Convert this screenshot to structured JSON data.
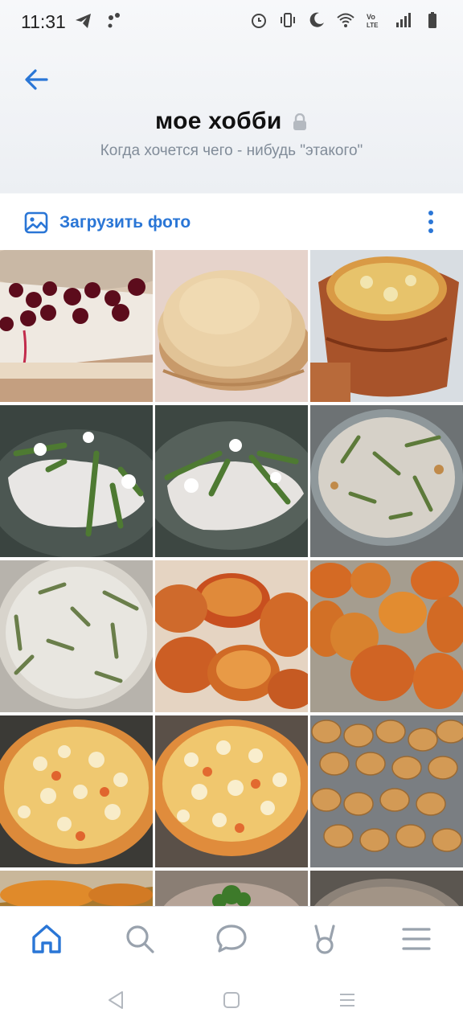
{
  "status_bar": {
    "time": "11:31"
  },
  "header": {
    "title": "мое хобби",
    "description": "Когда хочется чего - нибудь \"этакого\""
  },
  "actions": {
    "upload_label": "Загрузить фото"
  },
  "colors": {
    "accent": "#2a76d6",
    "secondary_text": "#818c99"
  },
  "photos": [
    {
      "subject": "cherry cake"
    },
    {
      "subject": "pancakes"
    },
    {
      "subject": "soup in clay pot"
    },
    {
      "subject": "fish with green beans"
    },
    {
      "subject": "fish with green beans"
    },
    {
      "subject": "green bean casserole"
    },
    {
      "subject": "green bean casserole"
    },
    {
      "subject": "baked pies"
    },
    {
      "subject": "baked pies"
    },
    {
      "subject": "pizza"
    },
    {
      "subject": "pizza"
    },
    {
      "subject": "nut cookies"
    },
    {
      "subject": "baked dish"
    },
    {
      "subject": "meat with herbs"
    },
    {
      "subject": "pie"
    }
  ],
  "bottom_nav": [
    "home-icon",
    "search-icon",
    "messages-icon",
    "services-icon",
    "menu-icon"
  ]
}
